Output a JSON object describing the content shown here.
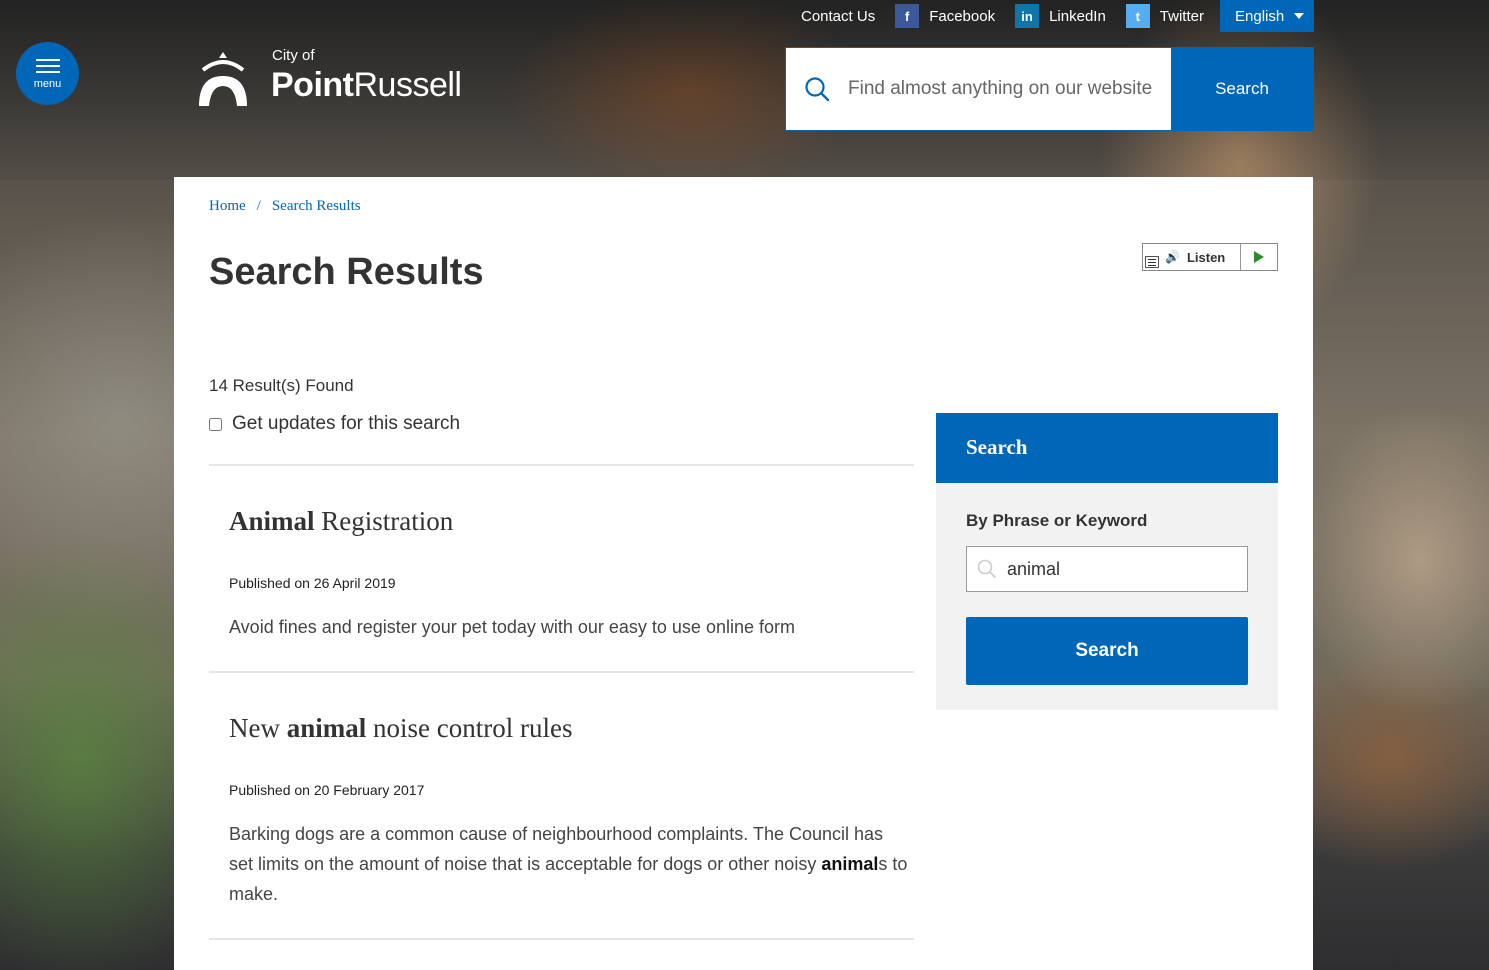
{
  "header": {
    "menu_label": "menu",
    "logo_city_of": "City of",
    "logo_name_bold": "Point",
    "logo_name_regular": "Russell",
    "top_links": {
      "contact": "Contact Us",
      "facebook": "Facebook",
      "linkedin": "LinkedIn",
      "twitter": "Twitter"
    },
    "social_glyphs": {
      "facebook": "f",
      "linkedin": "in",
      "twitter": "t"
    },
    "language": "English",
    "search_placeholder": "Find almost anything on our website",
    "search_button": "Search"
  },
  "breadcrumb": {
    "home": "Home",
    "separator": "/",
    "current": "Search Results"
  },
  "page_title": "Search Results",
  "listen_label": "Listen",
  "results_summary": {
    "count_text": "14 Result(s) Found",
    "updates_label": "Get updates for this search",
    "updates_checked": false
  },
  "results": [
    {
      "title_bold": "Animal",
      "title_rest": " Registration",
      "published": "Published on 26 April 2019",
      "description": "Avoid fines and register your pet today with our easy to use online form"
    },
    {
      "title_pre": "New ",
      "title_bold": "animal",
      "title_rest": " noise control rules",
      "published": "Published on 20 February 2017",
      "description_pre": "Barking dogs are a common cause of neighbourhood complaints. The Council has set limits on the amount of noise that is acceptable for dogs or other noisy ",
      "description_bold": "animal",
      "description_post": "s to make."
    }
  ],
  "sidebar": {
    "heading": "Search",
    "field_label": "By Phrase or Keyword",
    "keyword_value": "animal",
    "button": "Search"
  },
  "colors": {
    "primary_blue": "#0067b8",
    "panel_bg": "#ffffff",
    "sidebar_bg": "#f2f2f2"
  }
}
